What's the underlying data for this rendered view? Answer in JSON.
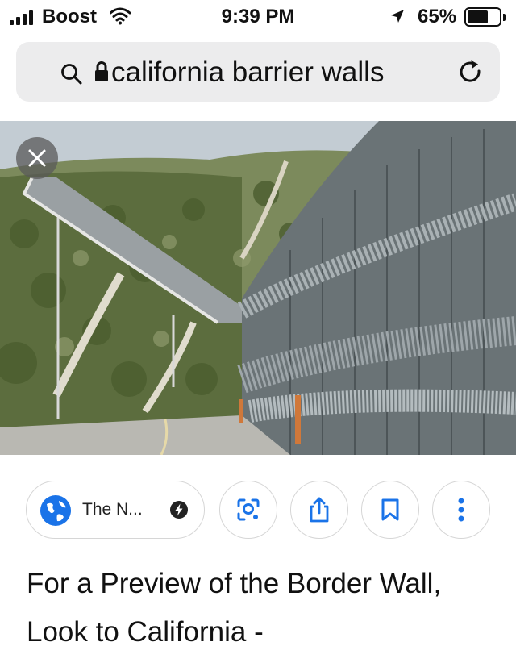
{
  "status_bar": {
    "carrier": "Boost",
    "time": "9:39 PM",
    "battery_percent": "65%",
    "battery_level": 0.65
  },
  "address_bar": {
    "query": "california barrier walls"
  },
  "image_viewer": {
    "icons": [
      "close-icon"
    ]
  },
  "actions": {
    "source_label": "The N...",
    "icons": [
      "globe-icon",
      "amp-lightning-icon",
      "lens-search-icon",
      "share-icon",
      "bookmark-icon",
      "more-vertical-icon"
    ]
  },
  "result": {
    "title": "For a Preview of the Border Wall, Look to California -"
  },
  "colors": {
    "accent_blue": "#1a73e8",
    "address_bar_bg": "#ececed",
    "chip_border": "#d6d6d6"
  }
}
